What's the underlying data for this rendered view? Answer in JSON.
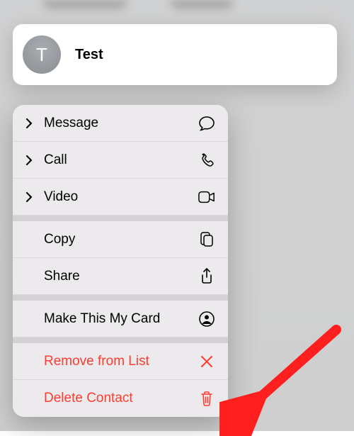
{
  "contact": {
    "initial": "T",
    "name": "Test"
  },
  "menu": {
    "message": "Message",
    "call": "Call",
    "video": "Video",
    "copy": "Copy",
    "share": "Share",
    "makeCard": "Make This My Card",
    "removeList": "Remove from List",
    "deleteContact": "Delete Contact"
  },
  "colors": {
    "destructive": "#ff3b30"
  }
}
